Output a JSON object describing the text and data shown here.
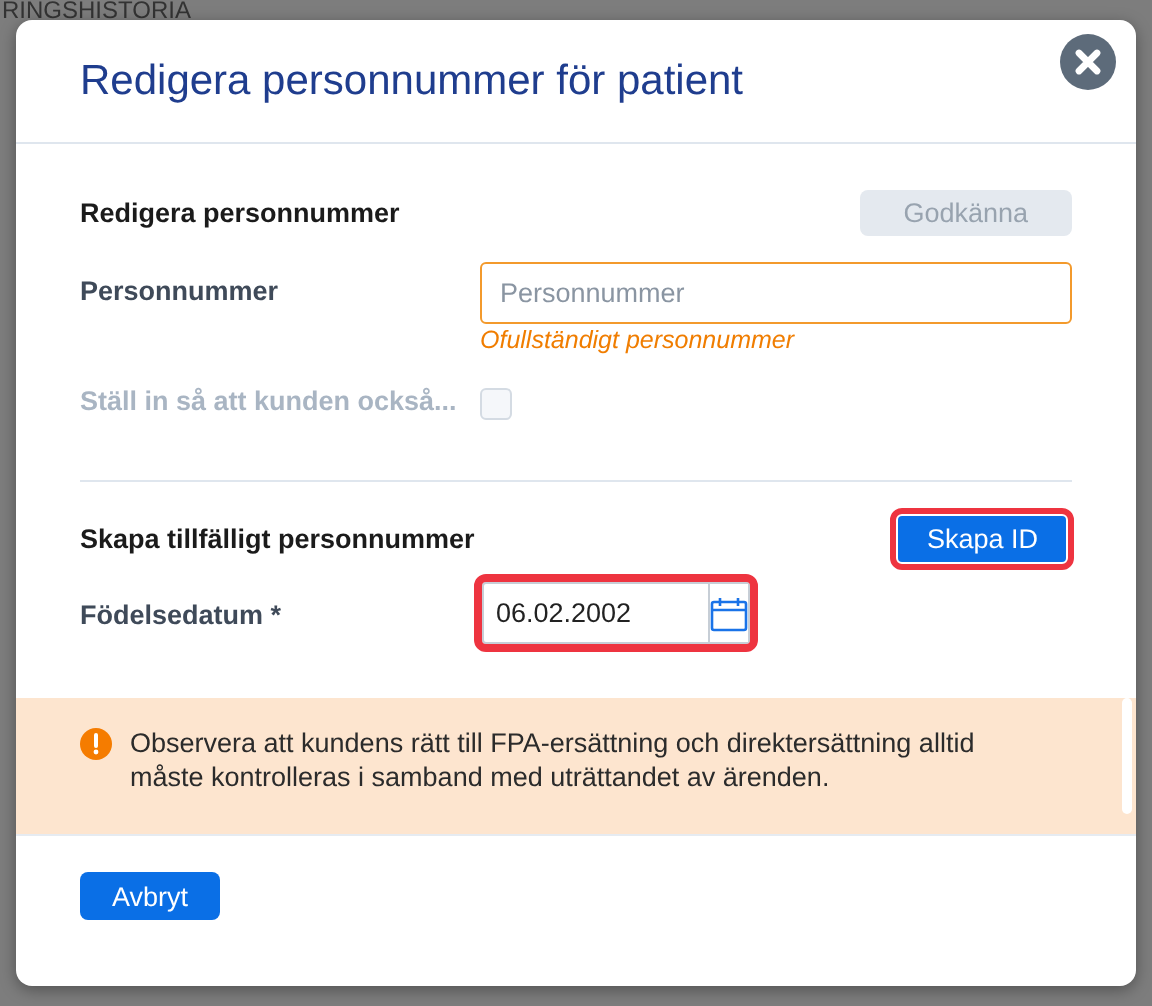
{
  "background": {
    "heading": "RINGSHISTORIA"
  },
  "dialog": {
    "title": "Redigera personnummer för patient",
    "sections": [
      {
        "heading": "Redigera personnummer",
        "action": {
          "label": "Godkänna",
          "disabled": true,
          "highlighted": false
        },
        "fields": [
          {
            "kind": "text",
            "label": "Personnummer",
            "placeholder": "Personnummer",
            "error": "Ofullständigt personnummer"
          },
          {
            "kind": "checkbox",
            "label": "Ställ in så att kunden också...",
            "disabled": true,
            "checked": false
          }
        ]
      },
      {
        "heading": "Skapa tillfälligt personnummer",
        "action": {
          "label": "Skapa ID",
          "disabled": false,
          "highlighted": true
        },
        "fields": [
          {
            "kind": "date",
            "label": "Födelsedatum *",
            "value": "06.02.2002",
            "highlighted": true
          }
        ]
      }
    ],
    "notice": {
      "text": "Observera att kundens rätt till FPA-ersättning och direktersättning alltid måste kontrolleras i samband med uträttandet av ärenden."
    },
    "footer_buttons": [
      {
        "label": "Avbryt"
      }
    ]
  }
}
